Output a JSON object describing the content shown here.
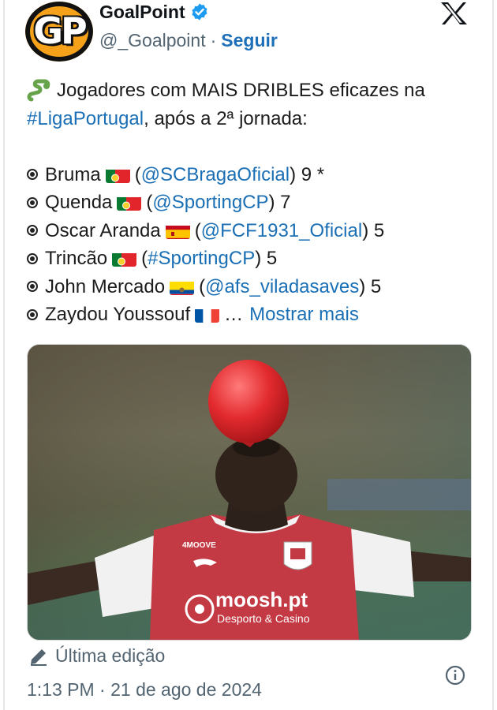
{
  "header": {
    "avatar_text": "GP",
    "display_name": "GoalPoint",
    "handle": "@_Goalpoint",
    "separator": "·",
    "follow_label": "Seguir"
  },
  "tweet": {
    "intro": "Jogadores com MAIS DRIBLES eficazes na",
    "hashtag": "#LigaPortugal",
    "intro_end": ", após a 2ª jornada:",
    "players": [
      {
        "name": "Bruma",
        "flag": "portugal",
        "open": "(",
        "mention": "@SCBragaOficial",
        "close": " ) 9 *"
      },
      {
        "name": "Quenda",
        "flag": "portugal",
        "open": "(",
        "mention": "@SportingCP",
        "close": " ) 7"
      },
      {
        "name": "Oscar Aranda",
        "flag": "spain",
        "open": "(",
        "mention": "@FCF1931_Oficial",
        "close": ") 5"
      },
      {
        "name": "Trincão",
        "flag": "portugal",
        "open": "(",
        "mention": "#SportingCP",
        "close": ") 5"
      },
      {
        "name": "John Mercado",
        "flag": "ecuador",
        "open": "(",
        "mention": "@afs_viladasaves",
        "close": ") 5"
      },
      {
        "name": "Zaydou Youssouf",
        "flag": "france",
        "ellipsis": "…",
        "more": "Mostrar mais"
      }
    ]
  },
  "photo": {
    "sponsor_main": "moosh.pt",
    "sponsor_sub": "Desporto & Casino",
    "kit_brand": "4MOOVE"
  },
  "footer": {
    "edit_label": "Última edição",
    "timestamp": "1:13 PM · 21 de ago de 2024"
  },
  "icons": {
    "verified": "verified-badge-icon",
    "x_logo": "x-logo-icon",
    "pencil": "pencil-icon",
    "info": "info-icon",
    "snake": "snake-emoji-icon"
  },
  "colors": {
    "link": "#1a6fb5",
    "verified": "#1d9bf0",
    "muted": "#536471",
    "jersey": "#c43a44"
  }
}
